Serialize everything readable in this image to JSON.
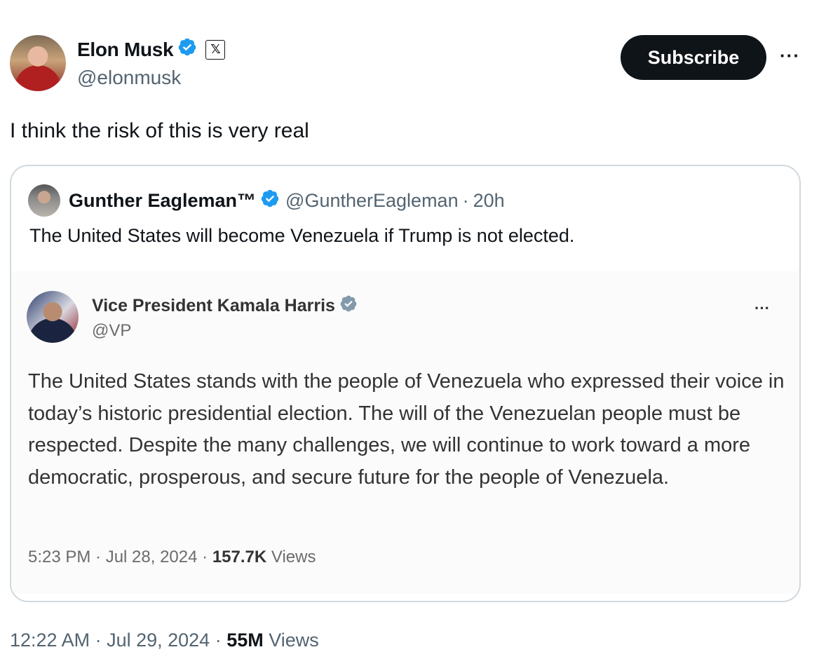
{
  "author": {
    "name": "Elon Musk",
    "handle": "@elonmusk",
    "affiliation_badge": "𝕏"
  },
  "subscribe_label": "Subscribe",
  "more_label": "···",
  "tweet_text": "I think the risk of this is very real",
  "quote": {
    "name": "Gunther Eagleman™",
    "handle": "@GuntherEagleman",
    "separator": "·",
    "time": "20h",
    "text": "The United States will become Venezuela if Trump is not elected.",
    "embedded": {
      "name": "Vice President Kamala Harris",
      "handle": "@VP",
      "more_label": "···",
      "body": "The United States stands with the people of Venezuela who expressed their voice in today’s historic presidential election. The will of the Venezuelan people must be respected. Despite the many challenges, we will continue to work toward a more democratic, prosperous, and secure future for the people of Venezuela.",
      "time": "5:23 PM · Jul 28, 2024 ·",
      "views_count": "157.7K",
      "views_label": "Views"
    }
  },
  "footer": {
    "time": "12:22 AM · Jul 29, 2024 ·",
    "views_count": "55M",
    "views_label": "Views"
  },
  "icons": {
    "verified": "verified-badge-icon",
    "gray_verified": "gray-verified-badge-icon"
  },
  "colors": {
    "verified_blue": "#1d9bf0",
    "gov_gray": "#829aab",
    "text_primary": "#0f1419",
    "text_secondary": "#536471"
  }
}
